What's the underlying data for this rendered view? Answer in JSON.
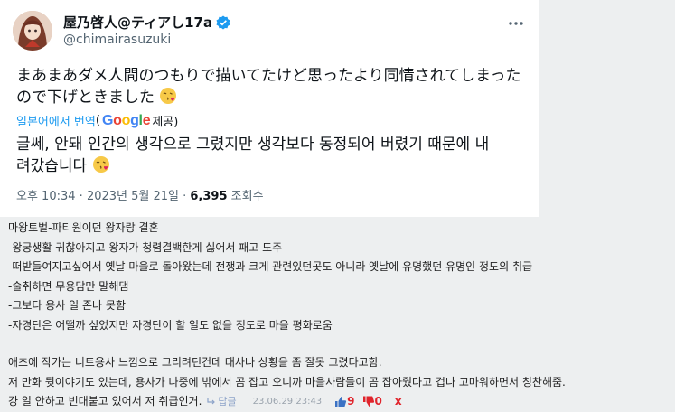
{
  "tweet": {
    "display_name": "屋乃啓人@ティアし17a",
    "handle": "@chimairasuzuki",
    "text_line1": "まあまあダメ人間のつもりで描いてたけど思ったより同情されてしまった",
    "text_line2": "ので下げときました",
    "translate_link": "일본어에서 번역",
    "translate_paren_open": "(",
    "translate_provider": "Google",
    "translate_suffix": " 제공)",
    "translated_line1": "글쎄, 안돼 인간의 생각으로 그렸지만 생각보다 동정되어 버렸기 때문에 내",
    "translated_line2": "려갔습니다",
    "time": "오후 10:34",
    "dot": " · ",
    "date": "2023년 5월 21일",
    "views": "6,395",
    "views_label": " 조회수",
    "icons": {
      "verified": "verified-badge-icon",
      "more": "more-dots-icon",
      "emoji": "kiss-emoji-icon"
    },
    "colors": {
      "link": "#1d9bf0",
      "verified": "#1d9bf0"
    }
  },
  "comment": {
    "lines": [
      "마왕토벌-파티원이던 왕자랑 결혼",
      "-왕궁생활 귀찮아지고 왕자가 청렴결백한게 싫어서 패고 도주",
      "-떠받들여지고싶어서 옛날 마을로 돌아왔는데 전쟁과 크게 관련있던곳도 아니라 옛날에 유명했던 유명인 정도의 취급",
      "-술취하면 무용담만 말해댐",
      "-그보다 용사 일 존나 못함",
      "-자경단은 어떨까 싶었지만 자경단이 할 일도 없을 정도로 마을 평화로움"
    ],
    "lines2": [
      "애초에 작가는 니트용사 느낌으로 그리려던건데 대사나 상황을 좀 잘못 그렸다고함.",
      "저 만화 뒷이야기도 있는데, 용사가 나중에 밖에서 곰 잡고 오니까 마을사람들이 곰 잡아줬다고 겁나 고마워하면서 칭찬해줌."
    ],
    "last_line": "걍 일 안하고 빈대붙고 있어서 저 취급인거.",
    "reply_label": "답글",
    "datetime": "23.06.29 23:43",
    "upvotes": "9",
    "downvotes": "0",
    "delete_label": "x"
  }
}
